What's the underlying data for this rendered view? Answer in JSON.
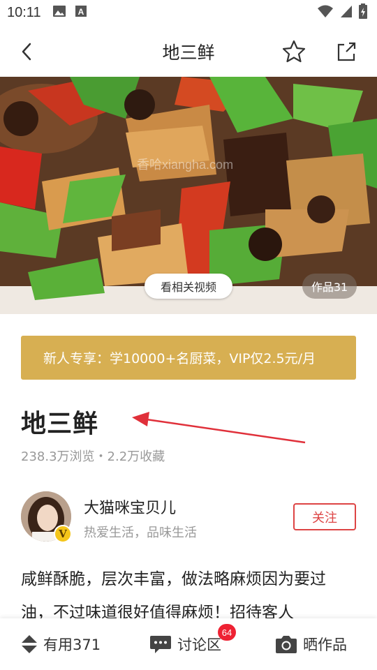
{
  "status_bar": {
    "time": "10:11"
  },
  "nav": {
    "title": "地三鲜"
  },
  "hero": {
    "watermark": "香哈xiangha.com",
    "video_button": "看相关视频",
    "works_badge": "作品31"
  },
  "vip_banner": {
    "text": "新人专享：学10000+名厨菜，VIP仅2.5元/月"
  },
  "recipe": {
    "title": "地三鲜",
    "stats": "238.3万浏览・2.2万收藏",
    "description": "咸鲜酥脆，层次丰富，做法略麻烦因为要过油，不过味道很好值得麻烦！招待客人"
  },
  "author": {
    "name": "大猫咪宝贝儿",
    "bio": "热爱生活，品味生活",
    "vip_badge": "V",
    "follow_label": "关注"
  },
  "bottom_bar": {
    "useful_label": "有用371",
    "discuss_label": "讨论区",
    "discuss_badge": "64",
    "share_label": "晒作品"
  },
  "colors": {
    "vip_banner": "#d7af52",
    "follow": "#dd4444",
    "badge": "#ee2233",
    "arrow": "#e0303a"
  }
}
